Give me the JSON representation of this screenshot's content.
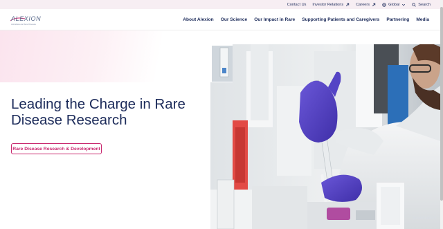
{
  "utility": {
    "contact": "Contact Us",
    "investor": "Investor Relations",
    "careers": "Careers",
    "global": "Global",
    "search": "Search"
  },
  "logo": {
    "name": "ALEXION",
    "tagline": "AstraZeneca Rare Disease"
  },
  "nav": {
    "items": [
      {
        "label": "About Alexion"
      },
      {
        "label": "Our Science"
      },
      {
        "label": "Our Impact in Rare"
      },
      {
        "label": "Supporting Patients and Caregivers"
      },
      {
        "label": "Partnering"
      },
      {
        "label": "Media"
      }
    ]
  },
  "hero": {
    "title": "Leading the Charge in Rare Disease Research",
    "cta": "Rare Disease Research & Development"
  },
  "colors": {
    "brand_navy": "#1c2b5a",
    "brand_magenta": "#c8266e",
    "utility_bg": "#f7eef3"
  },
  "icons": {
    "external": "external-link-icon",
    "globe": "globe-icon",
    "chevron": "chevron-down-icon",
    "search": "search-icon"
  }
}
